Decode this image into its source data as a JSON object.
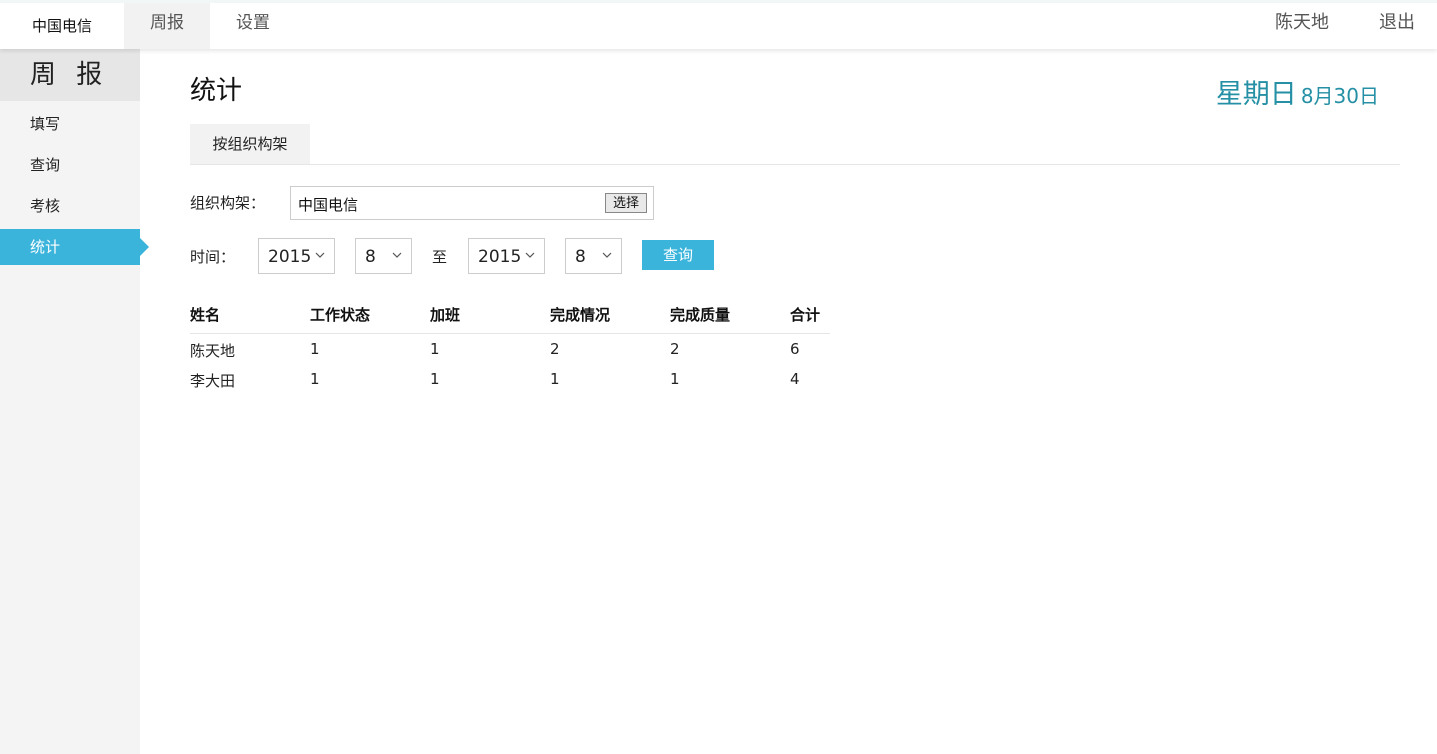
{
  "topbar": {
    "brand": "中国电信",
    "nav": [
      {
        "label": "周报"
      },
      {
        "label": "设置"
      }
    ],
    "user": "陈天地",
    "logout": "退出"
  },
  "sidebar": {
    "title": "周 报",
    "items": [
      {
        "label": "填写"
      },
      {
        "label": "查询"
      },
      {
        "label": "考核"
      },
      {
        "label": "统计"
      }
    ],
    "active_index": 3
  },
  "main": {
    "title": "统计",
    "weekday": "星期日",
    "date": "8月30日",
    "tab": "按组织构架",
    "org": {
      "label": "组织构架：",
      "value": "中国电信",
      "button": "选择"
    },
    "time": {
      "label": "时间：",
      "start_year": "2015",
      "start_month": "8",
      "to": "至",
      "end_year": "2015",
      "end_month": "8",
      "query_button": "查询"
    },
    "table": {
      "headers": [
        "姓名",
        "工作状态",
        "加班",
        "完成情况",
        "完成质量",
        "合计"
      ],
      "rows": [
        [
          "陈天地",
          "1",
          "1",
          "2",
          "2",
          "6"
        ],
        [
          "李大田",
          "1",
          "1",
          "1",
          "1",
          "4"
        ]
      ]
    }
  },
  "colors": {
    "accent": "#3bb4dc",
    "date": "#2590a5"
  }
}
